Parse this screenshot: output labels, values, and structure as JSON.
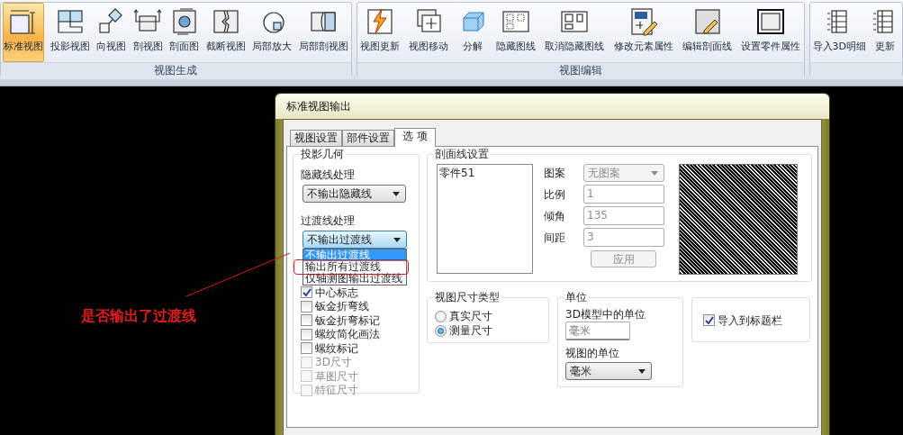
{
  "ribbon": {
    "groups": [
      {
        "label": "视图生成",
        "buttons": [
          {
            "label": "标准视图",
            "selected": true
          },
          {
            "label": "投影视图",
            "selected": false
          },
          {
            "label": "向视图",
            "selected": false
          },
          {
            "label": "剖视图",
            "selected": false
          },
          {
            "label": "剖面图",
            "selected": false
          },
          {
            "label": "截断视图",
            "selected": false
          },
          {
            "label": "局部放大",
            "selected": false
          },
          {
            "label": "局部剖视图",
            "selected": false
          }
        ]
      },
      {
        "label": "视图编辑",
        "buttons": [
          {
            "label": "视图更新",
            "selected": false
          },
          {
            "label": "视图移动",
            "selected": false
          },
          {
            "label": "分解",
            "selected": false
          },
          {
            "label": "隐藏图线",
            "selected": false
          },
          {
            "label": "取消隐藏图线",
            "selected": false
          },
          {
            "label": "修改元素属性",
            "selected": false
          },
          {
            "label": "编辑剖面线",
            "selected": false
          },
          {
            "label": "设置零件属性",
            "selected": false
          }
        ]
      },
      {
        "buttons": [
          {
            "label": "导入3D明细",
            "selected": false
          },
          {
            "label": "更新",
            "selected": false
          }
        ]
      }
    ]
  },
  "annotation": {
    "text": "是否输出了过渡线"
  },
  "dialog": {
    "title": "标准视图输出",
    "tabs": [
      {
        "label": "视图设置",
        "selected": false
      },
      {
        "label": "部件设置",
        "selected": false
      },
      {
        "label": "选 项",
        "selected": true
      }
    ],
    "projection": {
      "title": "投影几何",
      "hidden_line": {
        "label": "隐藏线处理",
        "value": "不输出隐藏线"
      },
      "transition_line": {
        "label": "过渡线处理",
        "value": "不输出过渡线",
        "expanded": true,
        "options": [
          {
            "label": "不输出过渡线",
            "selected": true,
            "highlighted": false
          },
          {
            "label": "输出所有过渡线",
            "selected": false,
            "highlighted": true
          },
          {
            "label": "仅轴测图输出过渡线",
            "selected": false,
            "highlighted": false
          }
        ]
      },
      "checkboxes": [
        {
          "label": "中心标志",
          "checked": true,
          "disabled": false
        },
        {
          "label": "钣金折弯线",
          "checked": false,
          "disabled": false
        },
        {
          "label": "钣金折弯标记",
          "checked": false,
          "disabled": false
        },
        {
          "label": "螺纹简化画法",
          "checked": false,
          "disabled": false
        },
        {
          "label": "螺纹标记",
          "checked": false,
          "disabled": false
        },
        {
          "label": "3D尺寸",
          "checked": false,
          "disabled": true
        },
        {
          "label": "草图尺寸",
          "checked": false,
          "disabled": true
        },
        {
          "label": "特征尺寸",
          "checked": false,
          "disabled": true
        }
      ]
    },
    "hatch": {
      "title": "剖面线设置",
      "parts": [
        {
          "label": "零件51"
        }
      ],
      "fields": [
        {
          "kind": "select",
          "label": "图案",
          "value": "无图案",
          "disabled": true
        },
        {
          "kind": "input",
          "label": "比例",
          "value": "1",
          "disabled": true
        },
        {
          "kind": "input",
          "label": "倾角",
          "value": "135",
          "disabled": true
        },
        {
          "kind": "input",
          "label": "间距",
          "value": "3",
          "disabled": true
        }
      ],
      "apply_button": {
        "label": "应用",
        "disabled": true
      }
    },
    "dimension_type": {
      "title": "视图尺寸类型",
      "options": [
        {
          "label": "真实尺寸",
          "selected": false
        },
        {
          "label": "测量尺寸",
          "selected": true
        }
      ]
    },
    "units": {
      "title": "单位",
      "model_unit": {
        "label": "3D模型中的单位",
        "value": "毫米"
      },
      "view_unit": {
        "label": "视图的单位",
        "value": "毫米"
      }
    },
    "title_block": {
      "label": "导入到标题栏",
      "checked": true
    }
  }
}
